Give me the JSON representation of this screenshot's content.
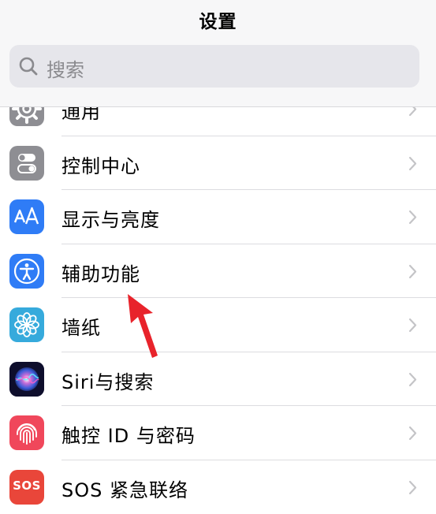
{
  "header": {
    "title": "设置"
  },
  "search": {
    "placeholder": "搜索"
  },
  "items": [
    {
      "label": "通用",
      "icon": "gear-icon",
      "color": "#8e8e93"
    },
    {
      "label": "控制中心",
      "icon": "toggles-icon",
      "color": "#8e8e93"
    },
    {
      "label": "显示与亮度",
      "icon": "text-size-icon",
      "color": "#2f7cf6"
    },
    {
      "label": "辅助功能",
      "icon": "accessibility-icon",
      "color": "#2f7cf6"
    },
    {
      "label": "墙纸",
      "icon": "flower-icon",
      "color": "#36aadc"
    },
    {
      "label": "Siri与搜索",
      "icon": "siri-icon",
      "color": "#1d1d40"
    },
    {
      "label": "触控 ID 与密码",
      "icon": "fingerprint-icon",
      "color": "#f0475b"
    },
    {
      "label": "SOS 紧急联络",
      "icon": "sos-icon",
      "color": "#e9463a",
      "icon_text": "SOS"
    }
  ],
  "annotation": {
    "color": "#e8232b",
    "icon": "red-arrow-icon"
  }
}
